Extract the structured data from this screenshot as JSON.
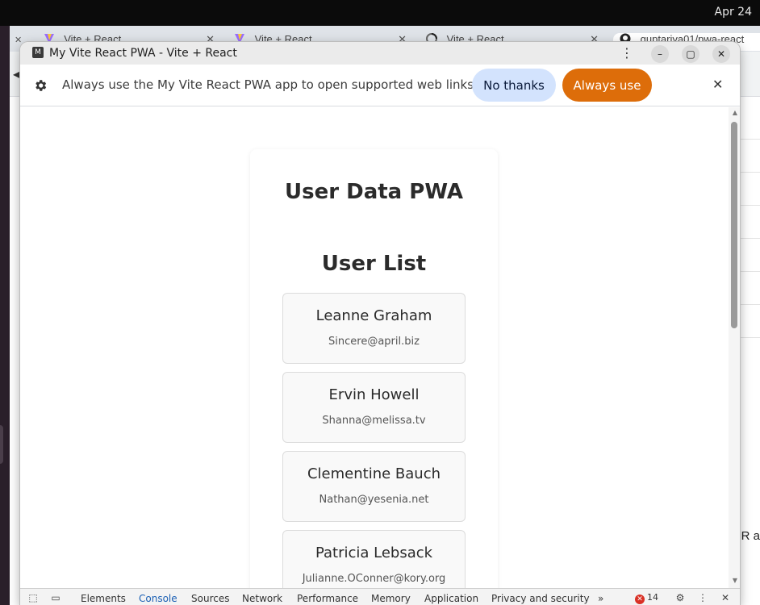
{
  "system": {
    "clock": "Apr 24"
  },
  "background_browser": {
    "tabs": [
      {
        "label": "Vite + React"
      },
      {
        "label": "Vite + React"
      },
      {
        "label": "Vite + React"
      },
      {
        "label": "guptariya01/pwa-react"
      }
    ],
    "side_text": "MR a"
  },
  "window": {
    "app_icon_letter": "M",
    "title": "My Vite React PWA - Vite + React"
  },
  "infobar": {
    "message": "Always use the My Vite React PWA app to open supported web links?",
    "no_label": "No thanks",
    "yes_label": "Always use",
    "accent_color": "#dd6d0a"
  },
  "app": {
    "title": "User Data PWA",
    "list_title": "User List",
    "users": [
      {
        "name": "Leanne Graham",
        "email": "Sincere@april.biz"
      },
      {
        "name": "Ervin Howell",
        "email": "Shanna@melissa.tv"
      },
      {
        "name": "Clementine Bauch",
        "email": "Nathan@yesenia.net"
      },
      {
        "name": "Patricia Lebsack",
        "email": "Julianne.OConner@kory.org"
      }
    ]
  },
  "devtools": {
    "tabs": [
      "Elements",
      "Console",
      "Sources",
      "Network",
      "Performance",
      "Memory",
      "Application",
      "Privacy and security"
    ],
    "active_tab": "Console",
    "more": "»",
    "error_count": "14"
  }
}
